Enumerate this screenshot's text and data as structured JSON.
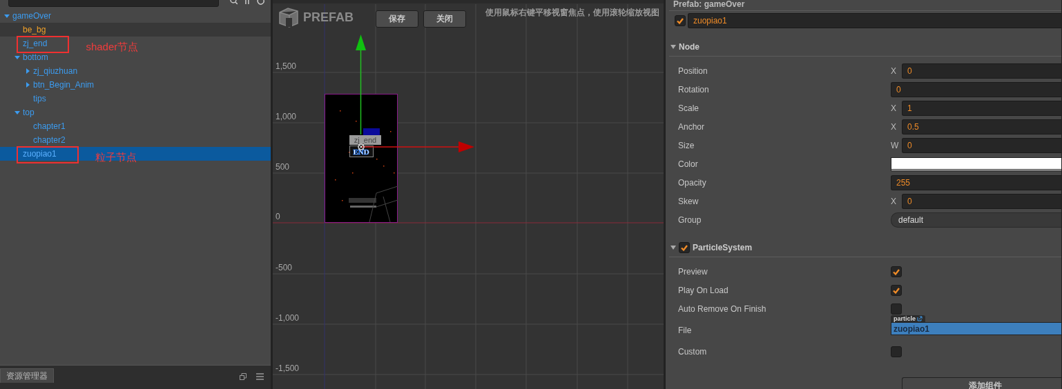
{
  "hierarchy": {
    "tree": [
      {
        "name": "gameOver",
        "color": "#3c9cf0",
        "expanded": true,
        "selected": false,
        "hovered": false,
        "children": [
          {
            "name": "be_bg",
            "color": "#f0a028",
            "selected": false,
            "hovered": true
          },
          {
            "name": "zj_end",
            "color": "#3c9cf0",
            "selected": false,
            "hovered": false,
            "annotation": "shader节点"
          },
          {
            "name": "bottom",
            "color": "#3c9cf0",
            "expanded": true,
            "selected": false,
            "hovered": false,
            "children": [
              {
                "name": "zj_qiuzhuan",
                "color": "#3c9cf0",
                "expanded": false,
                "selected": false,
                "hovered": false
              },
              {
                "name": "btn_Begin_Anim",
                "color": "#3c9cf0",
                "expanded": false,
                "selected": false,
                "hovered": false
              },
              {
                "name": "tips",
                "color": "#3c9cf0",
                "selected": false,
                "hovered": false
              }
            ]
          },
          {
            "name": "top",
            "color": "#3c9cf0",
            "expanded": true,
            "selected": false,
            "hovered": false,
            "children": [
              {
                "name": "chapter1",
                "color": "#3c9cf0",
                "selected": false,
                "hovered": false
              },
              {
                "name": "chapter2",
                "color": "#3c9cf0",
                "selected": false,
                "hovered": false
              }
            ]
          },
          {
            "name": "zuopiao1",
            "color": "#5ab0ff",
            "selected": true,
            "hovered": false,
            "annotation": "粒子节点"
          }
        ]
      }
    ]
  },
  "assets_panel": {
    "tab": "资源管理器"
  },
  "scene": {
    "logo": "PREFAB",
    "buttons": [
      "保存",
      "关闭"
    ],
    "hint": "使用鼠标右键平移视窗焦点，使用滚轮缩放视图",
    "y_ticks": [
      "1,500",
      "1,000",
      "500",
      "0",
      "-500",
      "-1,000",
      "-1,500"
    ],
    "node_label": "zj_end",
    "sprite_text": "END"
  },
  "inspector": {
    "header": "Prefab: gameOver",
    "node": {
      "active": true,
      "name": "zuopiao1"
    },
    "sections": [
      {
        "title": "Node",
        "expanded": true,
        "props": [
          {
            "kind": "vec",
            "label": "Position",
            "axis": "X",
            "value": "0"
          },
          {
            "kind": "number",
            "label": "Rotation",
            "value": "0"
          },
          {
            "kind": "vec",
            "label": "Scale",
            "axis": "X",
            "value": "1"
          },
          {
            "kind": "vec",
            "label": "Anchor",
            "axis": "X",
            "value": "0.5"
          },
          {
            "kind": "vec",
            "label": "Size",
            "axis": "W",
            "value": "0"
          },
          {
            "kind": "color",
            "label": "Color",
            "color": "#ffffff"
          },
          {
            "kind": "number",
            "label": "Opacity",
            "value": "255"
          },
          {
            "kind": "vec",
            "label": "Skew",
            "axis": "X",
            "value": "0"
          },
          {
            "kind": "select",
            "label": "Group",
            "value": "default"
          }
        ]
      },
      {
        "title": "ParticleSystem",
        "expanded": true,
        "enabled": true,
        "props": [
          {
            "kind": "checkbox",
            "label": "Preview",
            "checked": true
          },
          {
            "kind": "checkbox",
            "label": "Play On Load",
            "checked": true
          },
          {
            "kind": "checkbox",
            "label": "Auto Remove On Finish",
            "checked": false
          },
          {
            "kind": "asset",
            "label": "File",
            "tag": "particle",
            "value": "zuopiao1"
          },
          {
            "kind": "checkbox",
            "label": "Custom",
            "checked": false
          }
        ]
      }
    ],
    "add_button": "添加组件"
  }
}
